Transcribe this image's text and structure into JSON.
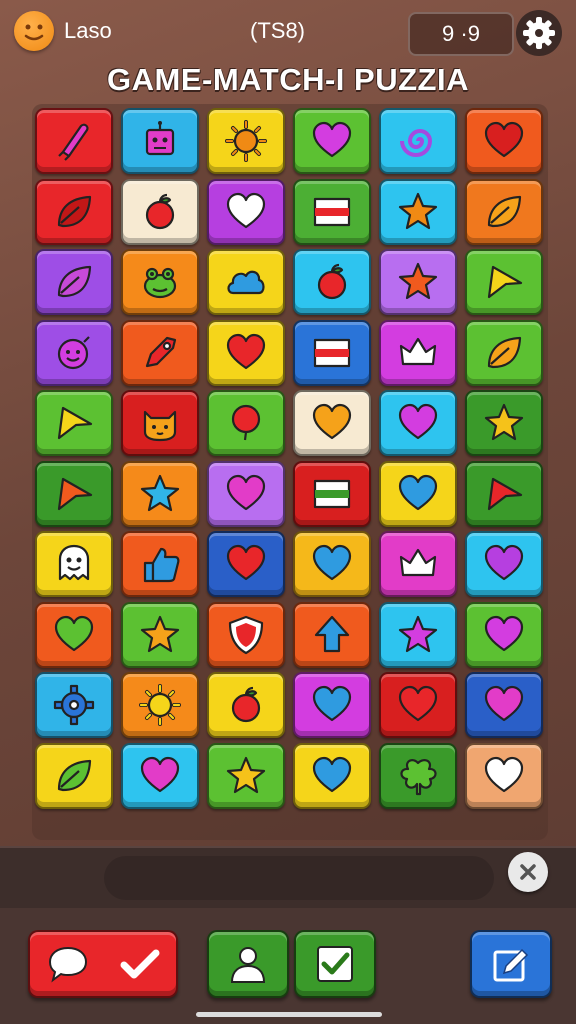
{
  "header": {
    "avatar_icon": "smiley-face-icon",
    "player_name": "Laso",
    "center_value": "(TS8)",
    "score": "9 ·9",
    "settings_icon": "gear-icon"
  },
  "title": "GAME-MATCH-I PUZZIA",
  "board": {
    "columns": 6,
    "rows": [
      [
        {
          "color": "#e8262a",
          "icon": "candy-icon",
          "fg": "#e23cc8"
        },
        {
          "color": "#30b4e8",
          "icon": "robot-icon",
          "fg": "#e23cc8"
        },
        {
          "color": "#f5d51a",
          "icon": "sun-icon",
          "fg": "#f08a14"
        },
        {
          "color": "#5cc132",
          "icon": "heart-icon",
          "fg": "#d33de0"
        },
        {
          "color": "#2ec4ef",
          "icon": "spiral-icon",
          "fg": "#a54ae0"
        },
        {
          "color": "#f05a1e",
          "icon": "heart-icon",
          "fg": "#d81f1f"
        }
      ],
      [
        {
          "color": "#e8262a",
          "icon": "leaf-icon",
          "fg": "#c21717"
        },
        {
          "color": "#f7ead2",
          "icon": "apple-icon",
          "fg": "#e8262a"
        },
        {
          "color": "#b63fe0",
          "icon": "heart-icon",
          "fg": "#ffffff"
        },
        {
          "color": "#4caf34",
          "icon": "flag-icon",
          "fg": "#e8262a"
        },
        {
          "color": "#2ec4ef",
          "icon": "star-icon",
          "fg": "#f08a14"
        },
        {
          "color": "#f0781e",
          "icon": "leaf-icon",
          "fg": "#f5a21a"
        }
      ],
      [
        {
          "color": "#9e4ee6",
          "icon": "leaf-icon",
          "fg": "#c74ad8"
        },
        {
          "color": "#f58a1a",
          "icon": "frog-icon",
          "fg": "#5cc132"
        },
        {
          "color": "#f5d51a",
          "icon": "cloud-icon",
          "fg": "#2f9be0"
        },
        {
          "color": "#2ec4ef",
          "icon": "apple-icon",
          "fg": "#e8262a"
        },
        {
          "color": "#b86ef0",
          "icon": "star-icon",
          "fg": "#f05a1e"
        },
        {
          "color": "#5cc132",
          "icon": "arrow-icon",
          "fg": "#f5d51a"
        }
      ],
      [
        {
          "color": "#9e4ee6",
          "icon": "face-icon",
          "fg": "#d33de0"
        },
        {
          "color": "#f05a1e",
          "icon": "rocket-icon",
          "fg": "#e8262a"
        },
        {
          "color": "#f5d51a",
          "icon": "heart-icon",
          "fg": "#e8262a"
        },
        {
          "color": "#2a74d8",
          "icon": "flag-icon",
          "fg": "#e8262a"
        },
        {
          "color": "#d33de0",
          "icon": "crown-icon",
          "fg": "#ffffff"
        },
        {
          "color": "#5cc132",
          "icon": "leaf-icon",
          "fg": "#f5a21a"
        }
      ],
      [
        {
          "color": "#5cc132",
          "icon": "arrow-icon",
          "fg": "#f5d51a"
        },
        {
          "color": "#d81f1f",
          "icon": "cat-icon",
          "fg": "#f5a21a"
        },
        {
          "color": "#5cc132",
          "icon": "balloon-icon",
          "fg": "#e8262a"
        },
        {
          "color": "#f7ead2",
          "icon": "heart-icon",
          "fg": "#f5a21a"
        },
        {
          "color": "#2ec4ef",
          "icon": "heart-icon",
          "fg": "#d33de0"
        },
        {
          "color": "#3a9a2a",
          "icon": "star-icon",
          "fg": "#f5c21a"
        }
      ],
      [
        {
          "color": "#3a9a2a",
          "icon": "arrow-icon",
          "fg": "#f05a1e"
        },
        {
          "color": "#f58a1a",
          "icon": "star-icon",
          "fg": "#30b4e8"
        },
        {
          "color": "#b86ef0",
          "icon": "heart-icon",
          "fg": "#e23cc8"
        },
        {
          "color": "#d81f1f",
          "icon": "flag-icon",
          "fg": "#3a9a2a"
        },
        {
          "color": "#f5d51a",
          "icon": "heart-icon",
          "fg": "#2f9be0"
        },
        {
          "color": "#3a9a2a",
          "icon": "arrow-icon",
          "fg": "#e8262a"
        }
      ],
      [
        {
          "color": "#f5d51a",
          "icon": "ghost-icon",
          "fg": "#ffffff"
        },
        {
          "color": "#f05a1e",
          "icon": "thumb-icon",
          "fg": "#2f9be0"
        },
        {
          "color": "#2a5fc8",
          "icon": "heart-icon",
          "fg": "#e8262a"
        },
        {
          "color": "#f5b81a",
          "icon": "heart-icon",
          "fg": "#2f9be0"
        },
        {
          "color": "#e23cc8",
          "icon": "crown-icon",
          "fg": "#ffffff"
        },
        {
          "color": "#2ec4ef",
          "icon": "heart-icon",
          "fg": "#b63fe0"
        }
      ],
      [
        {
          "color": "#f05a1e",
          "icon": "heart-icon",
          "fg": "#5cc132"
        },
        {
          "color": "#5cc132",
          "icon": "star-icon",
          "fg": "#f5a21a"
        },
        {
          "color": "#f05a1e",
          "icon": "shield-icon",
          "fg": "#e8262a"
        },
        {
          "color": "#f05a1e",
          "icon": "arrow-up-icon",
          "fg": "#2f9be0"
        },
        {
          "color": "#2ec4ef",
          "icon": "star-icon",
          "fg": "#d33de0"
        },
        {
          "color": "#5cc132",
          "icon": "heart-icon",
          "fg": "#d33de0"
        }
      ],
      [
        {
          "color": "#30b4e8",
          "icon": "gear-icon",
          "fg": "#2a74d8"
        },
        {
          "color": "#f58a1a",
          "icon": "sun-icon",
          "fg": "#f5d51a"
        },
        {
          "color": "#f5d51a",
          "icon": "apple-icon",
          "fg": "#e8262a"
        },
        {
          "color": "#d33de0",
          "icon": "heart-icon",
          "fg": "#2f9be0"
        },
        {
          "color": "#d81f1f",
          "icon": "heart-icon",
          "fg": "#e8262a"
        },
        {
          "color": "#2a5fc8",
          "icon": "heart-icon",
          "fg": "#e23cc8"
        }
      ],
      [
        {
          "color": "#f5d51a",
          "icon": "leaf-icon",
          "fg": "#5cc132"
        },
        {
          "color": "#2ec4ef",
          "icon": "heart-icon",
          "fg": "#e23cc8"
        },
        {
          "color": "#5cc132",
          "icon": "star-icon",
          "fg": "#f5c21a"
        },
        {
          "color": "#f5d51a",
          "icon": "heart-icon",
          "fg": "#2f9be0"
        },
        {
          "color": "#3a9a2a",
          "icon": "clover-icon",
          "fg": "#5cc132"
        },
        {
          "color": "#f0a670",
          "icon": "heart-icon",
          "fg": "#ffffff"
        }
      ]
    ]
  },
  "shelf": {
    "close_icon": "close-icon"
  },
  "actions": [
    {
      "name": "chat-confirm-button",
      "icon": "speech-bubble-icon",
      "color": "#e8262a"
    },
    {
      "name": "profile-button",
      "icon": "person-icon",
      "color": "#3a9a2a"
    },
    {
      "name": "check-button",
      "icon": "checkbox-icon",
      "color": "#3a9a2a"
    },
    {
      "name": "edit-button",
      "icon": "edit-icon",
      "color": "#2a74d8"
    }
  ]
}
